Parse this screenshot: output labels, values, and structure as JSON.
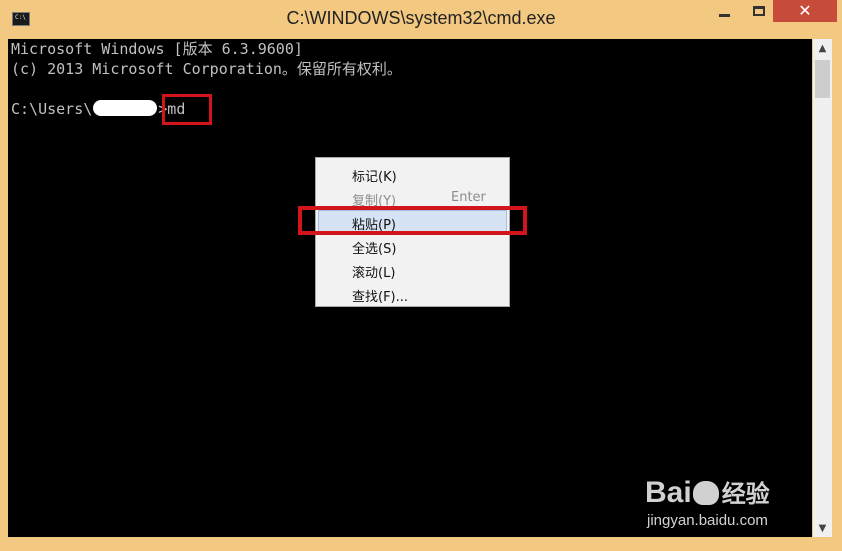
{
  "window": {
    "title": "C:\\WINDOWS\\system32\\cmd.exe",
    "icon": "cmd-icon",
    "icon_text": "C:\\",
    "accent_color": "#f3c981",
    "close_color": "#c74b3a"
  },
  "console": {
    "line1": "Microsoft Windows [版本 6.3.9600]",
    "line2": "(c) 2013 Microsoft Corporation。保留所有权利。",
    "prompt_prefix": "C:\\Users\\",
    "prompt_suffix": ">md"
  },
  "context_menu": {
    "items": [
      {
        "label": "标记(K)",
        "shortcut": "",
        "enabled": true,
        "selected": false
      },
      {
        "label": "复制(Y)",
        "shortcut": "Enter",
        "enabled": false,
        "selected": false
      },
      {
        "label": "粘贴(P)",
        "shortcut": "",
        "enabled": true,
        "selected": true
      },
      {
        "label": "全选(S)",
        "shortcut": "",
        "enabled": true,
        "selected": false
      },
      {
        "label": "滚动(L)",
        "shortcut": "",
        "enabled": true,
        "selected": false
      },
      {
        "label": "查找(F)...",
        "shortcut": "",
        "enabled": true,
        "selected": false
      }
    ]
  },
  "watermark": {
    "logo_left": "Bai",
    "logo_right": "经验",
    "url": "jingyan.baidu.com"
  },
  "highlight_color": "#d4141b"
}
